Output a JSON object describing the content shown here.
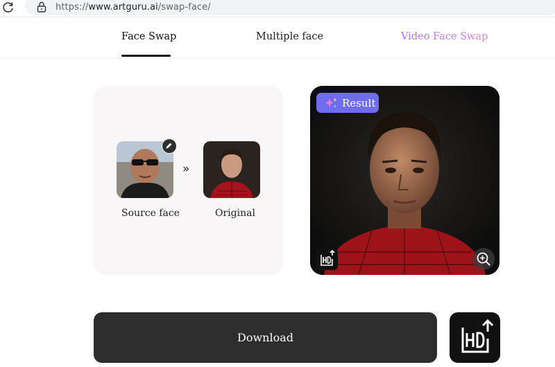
{
  "browser": {
    "url_prefix": "https://",
    "url_domain": "www.artguru.ai",
    "url_path": "/swap-face/"
  },
  "tabs": [
    {
      "label": "Face Swap",
      "active": true
    },
    {
      "label": "Multiple face",
      "active": false
    },
    {
      "label": "Video Face Swap",
      "active": false
    }
  ],
  "left_panel": {
    "separator": "»",
    "source_label": "Source face",
    "original_label": "Original"
  },
  "result_panel": {
    "badge_label": "Result",
    "badge_color": "#6f6cf0"
  },
  "bottom": {
    "download_label": "Download"
  },
  "icons": [
    "reload-icon",
    "lock-icon",
    "edit-icon",
    "sparkle-icon",
    "hd-upscale-icon",
    "zoom-in-icon"
  ]
}
